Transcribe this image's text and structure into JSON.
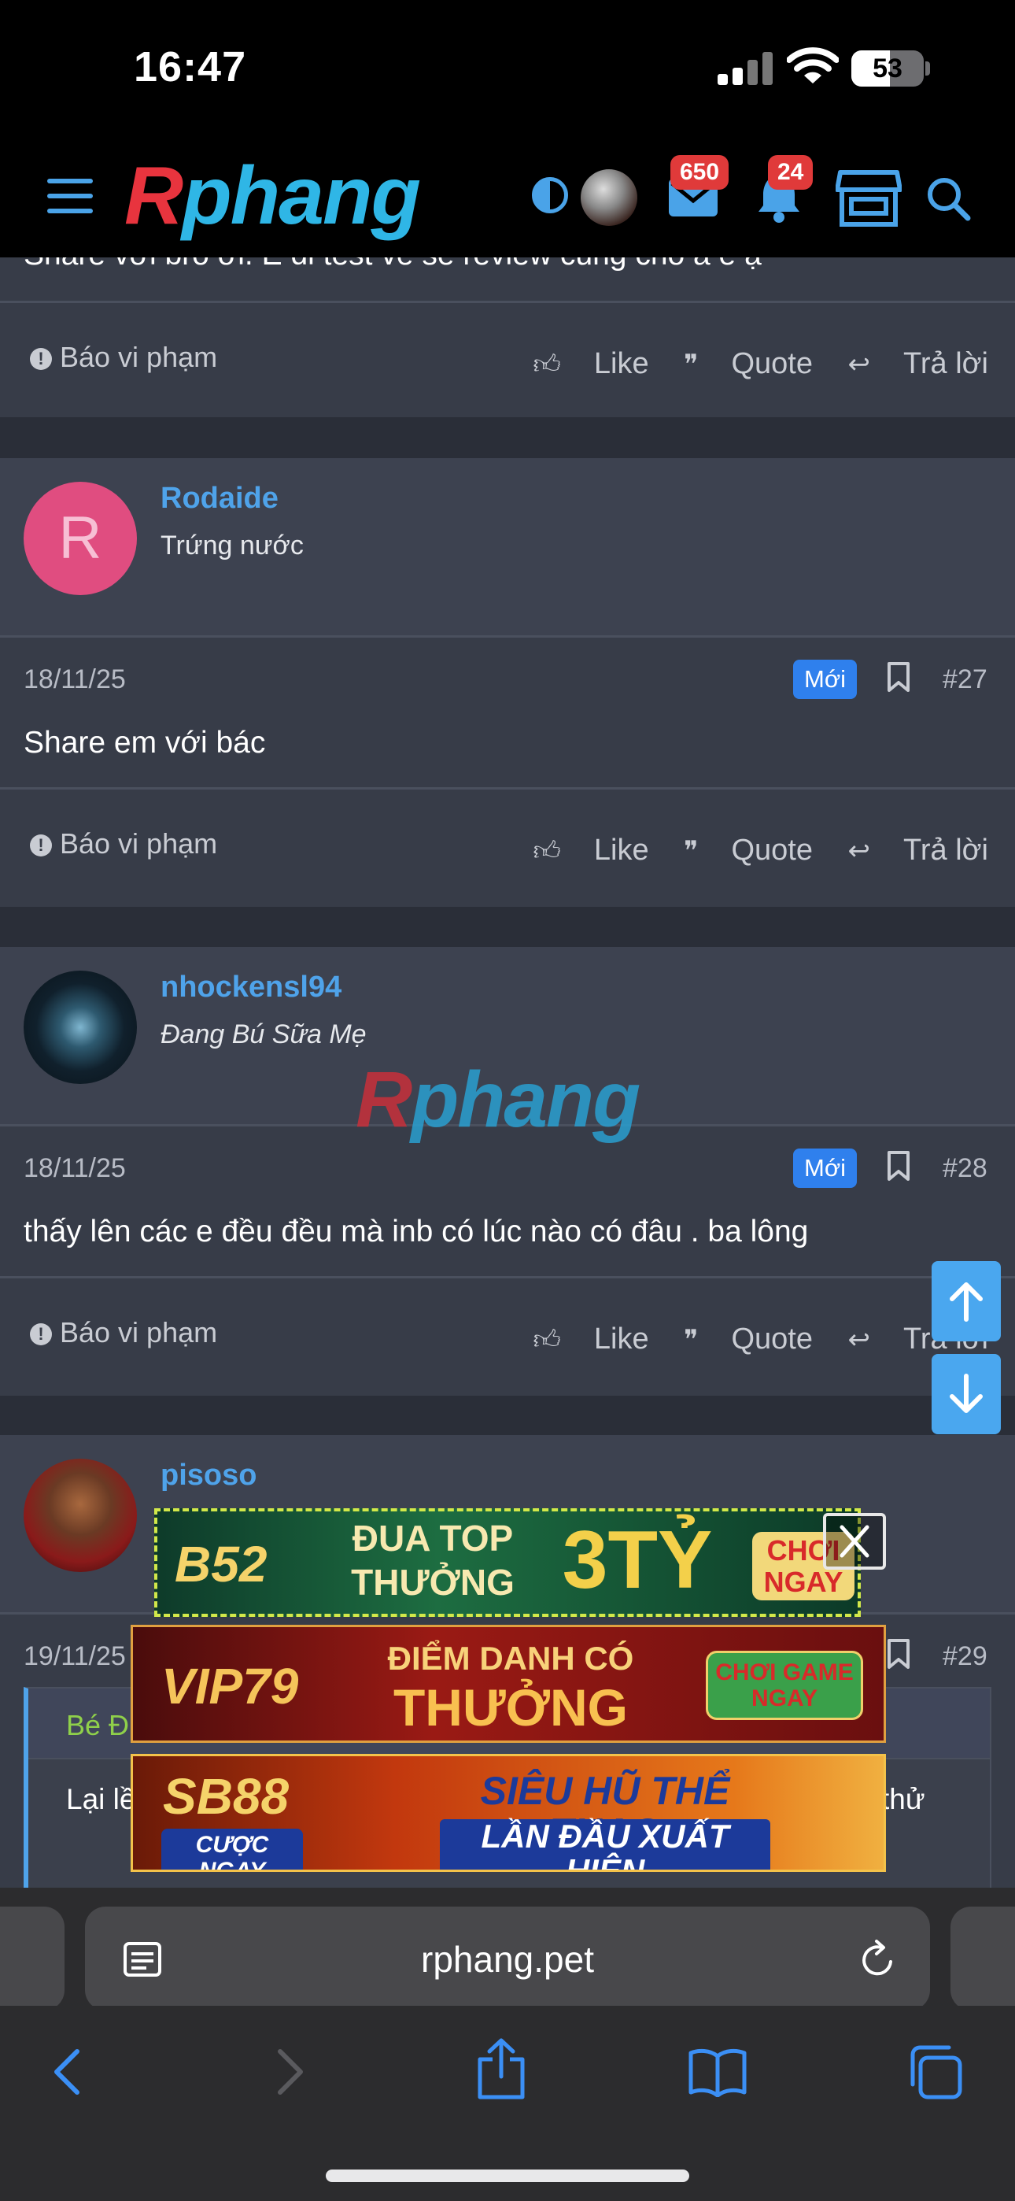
{
  "status_bar": {
    "time": "16:47",
    "battery": "53",
    "battery_level": 0.53
  },
  "header": {
    "logo_r": "R",
    "logo_rest": "phang",
    "inbox_badge": "650",
    "alerts_badge": "24"
  },
  "prev_post": {
    "partial_text": "Share với bro ơi. E di test về sẽ review cùng cho a e ạ",
    "report_label": "Báo vi phạm",
    "like_label": "Like",
    "quote_label": "Quote",
    "reply_label": "Trả lời"
  },
  "posts": [
    {
      "avatar_letter": "R",
      "username": "Rodaide",
      "user_title": "Trứng nước",
      "date": "18/11/25",
      "new_label": "Mới",
      "number": "#27",
      "body": "Share em với bác",
      "report_label": "Báo vi phạm",
      "like_label": "Like",
      "quote_label": "Quote",
      "reply_label": "Trả lời"
    },
    {
      "username": "nhockensl94",
      "user_title": "Đang Bú Sữa Mẹ",
      "date": "18/11/25",
      "new_label": "Mới",
      "number": "#28",
      "body": "thấy lên các e đều đều mà inb có lúc nào có đâu . ba lông",
      "report_label": "Báo vi phạm",
      "like_label": "Like",
      "quote_label": "Quote",
      "reply_label": "Trả lời"
    },
    {
      "username": "pisoso",
      "date": "19/11/25",
      "number": "#29",
      "quote_author": "Bé Đ",
      "quote_text_start": "Lại lề",
      "quote_text_end": "thử"
    }
  ],
  "watermark": {
    "r": "R",
    "rest": "phang"
  },
  "ads": [
    {
      "brand": "B52",
      "line1": "ĐUA TOP",
      "line2": "THƯỞNG",
      "big": "3TỶ",
      "cta": "CHƠI NGAY"
    },
    {
      "brand": "VIP79",
      "line1": "ĐIỂM DANH CÓ",
      "line2": "THƯỞNG",
      "cta": "CHƠI GAME NGAY"
    },
    {
      "brand": "SB88",
      "sub": "CƯỢC NGAY",
      "line1": "SIÊU HŨ THỂ THAO",
      "line2": "LẦN ĐẦU XUẤT HIỆN"
    }
  ],
  "safari": {
    "url": "rphang.pet"
  },
  "colors": {
    "accent": "#4fa3ea",
    "badge_red": "#e03a3a",
    "new_badge": "#2f80ed",
    "logo_red": "#e8343e",
    "logo_blue": "#2fb6e6"
  }
}
